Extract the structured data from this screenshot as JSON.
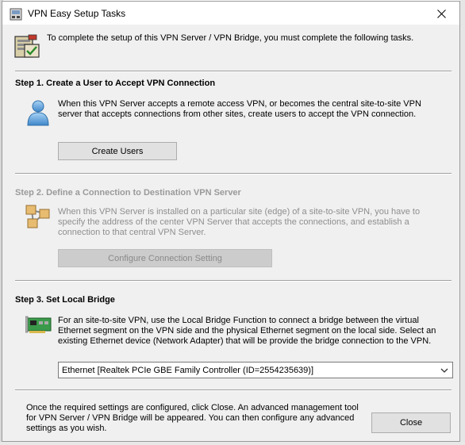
{
  "window": {
    "title": "VPN Easy Setup Tasks",
    "close_glyph": "✕"
  },
  "header": {
    "text": "To complete the setup of this VPN Server / VPN Bridge, you must complete the following tasks."
  },
  "step1": {
    "title": "Step 1. Create a User to Accept VPN Connection",
    "description": "When this VPN Server accepts a remote access VPN, or becomes the central site-to-site VPN server that accepts connections from other sites, create users to accept the VPN connection.",
    "button_label": "Create Users",
    "icon": "user-icon"
  },
  "step2": {
    "title": "Step 2. Define a Connection to Destination VPN Server",
    "description": "When this VPN Server is installed on a particular site (edge) of a site-to-site VPN, you have to specify the address of the center VPN Server that accepts the connections, and establish a connection to that central VPN Server.",
    "button_label": "Configure Connection Setting",
    "icon": "network-icon",
    "enabled": false
  },
  "step3": {
    "title": "Step 3. Set Local Bridge",
    "description": "For an site-to-site VPN, use the Local Bridge Function to connect a bridge between the virtual Ethernet segment on the VPN side and the physical Ethernet segment on the local side. Select an existing Ethernet device (Network Adapter) that will be provide the bridge connection to the VPN.",
    "adapter_selected": "Ethernet [Realtek PCIe GBE Family Controller (ID=2554235639)]",
    "icon": "network-card-icon"
  },
  "footer": {
    "text": "Once the required settings are configured, click Close. An advanced management tool for VPN Server / VPN Bridge will be appeared. You can then configure any advanced settings as you wish.",
    "close_label": "Close"
  }
}
